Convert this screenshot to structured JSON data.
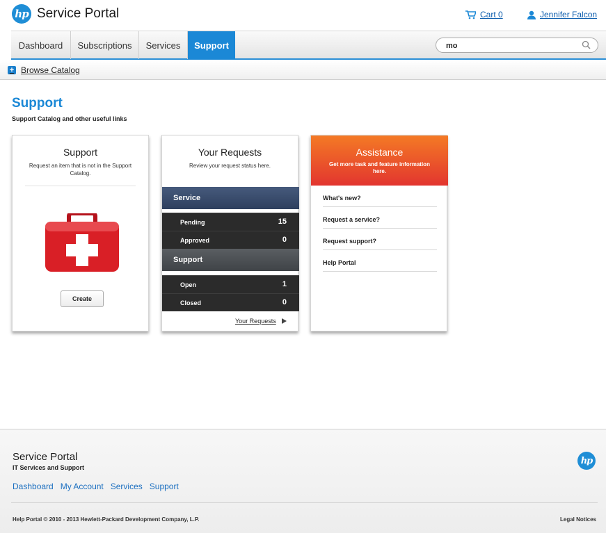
{
  "header": {
    "brand": "Service Portal",
    "logo_text": "hp",
    "cart_label": "Cart 0",
    "user_name": "Jennifer Falcon"
  },
  "nav": {
    "tabs": [
      {
        "label": "Dashboard"
      },
      {
        "label": "Subscriptions"
      },
      {
        "label": "Services"
      },
      {
        "label": "Support",
        "active": true
      }
    ],
    "search_value": "mo"
  },
  "subnav": {
    "browse_label": "Browse Catalog"
  },
  "page": {
    "title": "Support",
    "subtitle": "Support Catalog and other useful links"
  },
  "support_card": {
    "title": "Support",
    "description": "Request an item that is not in the Support Catalog.",
    "create_label": "Create"
  },
  "requests_card": {
    "title": "Your Requests",
    "description": "Review your request status here.",
    "service_header": "Service",
    "service_rows": [
      {
        "label": "Pending",
        "count": "15"
      },
      {
        "label": "Approved",
        "count": "0"
      }
    ],
    "support_header": "Support",
    "support_rows": [
      {
        "label": "Open",
        "count": "1"
      },
      {
        "label": "Closed",
        "count": "0"
      }
    ],
    "link_label": "Your Requests"
  },
  "assistance_card": {
    "title": "Assistance",
    "description": "Get more task and feature information here.",
    "links": [
      "What's new?",
      "Request a service?",
      "Request support?",
      "Help Portal"
    ]
  },
  "footer": {
    "title": "Service Portal",
    "subtitle": "IT Services and Support",
    "links": [
      "Dashboard",
      "My Account",
      "Services",
      "Support"
    ],
    "copyright": "Help Portal  © 2010 - 2013 Hewlett-Packard Development Company, L.P.",
    "legal": "Legal Notices"
  },
  "colors": {
    "accent": "#1b88d6",
    "assist_orange": "#f47a25",
    "assist_red": "#e2352f",
    "service_header": "#3a4c6c",
    "dark_row": "#2b2b2b"
  }
}
